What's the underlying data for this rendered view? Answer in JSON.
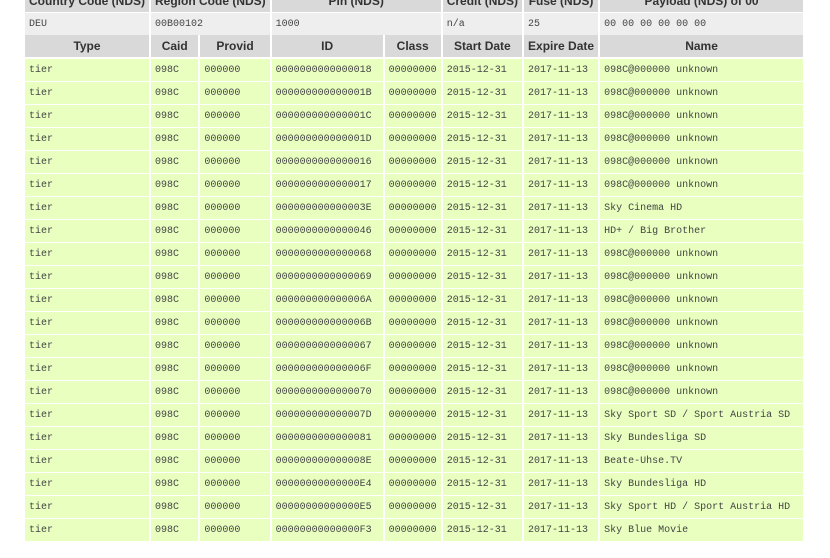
{
  "top_headers": [
    "Country Code (NDS)",
    "Region Code (NDS)",
    "Pin (NDS)",
    "Credit (NDS)",
    "Fuse (NDS)",
    "Payload (NDS) of 00"
  ],
  "info": {
    "country": "DEU",
    "region": "00B00102",
    "pin": "1000",
    "credit": "n/a",
    "fuse": "25",
    "payload": "00 00 00 00 00 00"
  },
  "columns": [
    "Type",
    "Caid",
    "Provid",
    "ID",
    "Class",
    "Start Date",
    "Expire Date",
    "Name"
  ],
  "rows": [
    {
      "type": "tier",
      "caid": "098C",
      "provid": "000000",
      "id": "0000000000000018",
      "class": "00000000",
      "start": "2015-12-31",
      "expire": "2017-11-13",
      "name": "098C@000000 unknown"
    },
    {
      "type": "tier",
      "caid": "098C",
      "provid": "000000",
      "id": "000000000000001B",
      "class": "00000000",
      "start": "2015-12-31",
      "expire": "2017-11-13",
      "name": "098C@000000 unknown"
    },
    {
      "type": "tier",
      "caid": "098C",
      "provid": "000000",
      "id": "000000000000001C",
      "class": "00000000",
      "start": "2015-12-31",
      "expire": "2017-11-13",
      "name": "098C@000000 unknown"
    },
    {
      "type": "tier",
      "caid": "098C",
      "provid": "000000",
      "id": "000000000000001D",
      "class": "00000000",
      "start": "2015-12-31",
      "expire": "2017-11-13",
      "name": "098C@000000 unknown"
    },
    {
      "type": "tier",
      "caid": "098C",
      "provid": "000000",
      "id": "0000000000000016",
      "class": "00000000",
      "start": "2015-12-31",
      "expire": "2017-11-13",
      "name": "098C@000000 unknown"
    },
    {
      "type": "tier",
      "caid": "098C",
      "provid": "000000",
      "id": "0000000000000017",
      "class": "00000000",
      "start": "2015-12-31",
      "expire": "2017-11-13",
      "name": "098C@000000 unknown"
    },
    {
      "type": "tier",
      "caid": "098C",
      "provid": "000000",
      "id": "000000000000003E",
      "class": "00000000",
      "start": "2015-12-31",
      "expire": "2017-11-13",
      "name": "Sky Cinema HD"
    },
    {
      "type": "tier",
      "caid": "098C",
      "provid": "000000",
      "id": "0000000000000046",
      "class": "00000000",
      "start": "2015-12-31",
      "expire": "2017-11-13",
      "name": "HD+ / Big Brother"
    },
    {
      "type": "tier",
      "caid": "098C",
      "provid": "000000",
      "id": "0000000000000068",
      "class": "00000000",
      "start": "2015-12-31",
      "expire": "2017-11-13",
      "name": "098C@000000 unknown"
    },
    {
      "type": "tier",
      "caid": "098C",
      "provid": "000000",
      "id": "0000000000000069",
      "class": "00000000",
      "start": "2015-12-31",
      "expire": "2017-11-13",
      "name": "098C@000000 unknown"
    },
    {
      "type": "tier",
      "caid": "098C",
      "provid": "000000",
      "id": "000000000000006A",
      "class": "00000000",
      "start": "2015-12-31",
      "expire": "2017-11-13",
      "name": "098C@000000 unknown"
    },
    {
      "type": "tier",
      "caid": "098C",
      "provid": "000000",
      "id": "000000000000006B",
      "class": "00000000",
      "start": "2015-12-31",
      "expire": "2017-11-13",
      "name": "098C@000000 unknown"
    },
    {
      "type": "tier",
      "caid": "098C",
      "provid": "000000",
      "id": "0000000000000067",
      "class": "00000000",
      "start": "2015-12-31",
      "expire": "2017-11-13",
      "name": "098C@000000 unknown"
    },
    {
      "type": "tier",
      "caid": "098C",
      "provid": "000000",
      "id": "000000000000006F",
      "class": "00000000",
      "start": "2015-12-31",
      "expire": "2017-11-13",
      "name": "098C@000000 unknown"
    },
    {
      "type": "tier",
      "caid": "098C",
      "provid": "000000",
      "id": "0000000000000070",
      "class": "00000000",
      "start": "2015-12-31",
      "expire": "2017-11-13",
      "name": "098C@000000 unknown"
    },
    {
      "type": "tier",
      "caid": "098C",
      "provid": "000000",
      "id": "000000000000007D",
      "class": "00000000",
      "start": "2015-12-31",
      "expire": "2017-11-13",
      "name": "Sky Sport SD / Sport Austria SD"
    },
    {
      "type": "tier",
      "caid": "098C",
      "provid": "000000",
      "id": "0000000000000081",
      "class": "00000000",
      "start": "2015-12-31",
      "expire": "2017-11-13",
      "name": "Sky Bundesliga SD"
    },
    {
      "type": "tier",
      "caid": "098C",
      "provid": "000000",
      "id": "000000000000008E",
      "class": "00000000",
      "start": "2015-12-31",
      "expire": "2017-11-13",
      "name": "Beate-Uhse.TV"
    },
    {
      "type": "tier",
      "caid": "098C",
      "provid": "000000",
      "id": "00000000000000E4",
      "class": "00000000",
      "start": "2015-12-31",
      "expire": "2017-11-13",
      "name": "Sky Bundesliga HD"
    },
    {
      "type": "tier",
      "caid": "098C",
      "provid": "000000",
      "id": "00000000000000E5",
      "class": "00000000",
      "start": "2015-12-31",
      "expire": "2017-11-13",
      "name": "Sky Sport HD / Sport Austria HD"
    },
    {
      "type": "tier",
      "caid": "098C",
      "provid": "000000",
      "id": "00000000000000F3",
      "class": "00000000",
      "start": "2015-12-31",
      "expire": "2017-11-13",
      "name": "Sky Blue Movie"
    }
  ],
  "colors": {
    "row_bg": "#e9ffc0",
    "header_bg": "#d9d9d9",
    "info_bg": "#eeeeee"
  }
}
